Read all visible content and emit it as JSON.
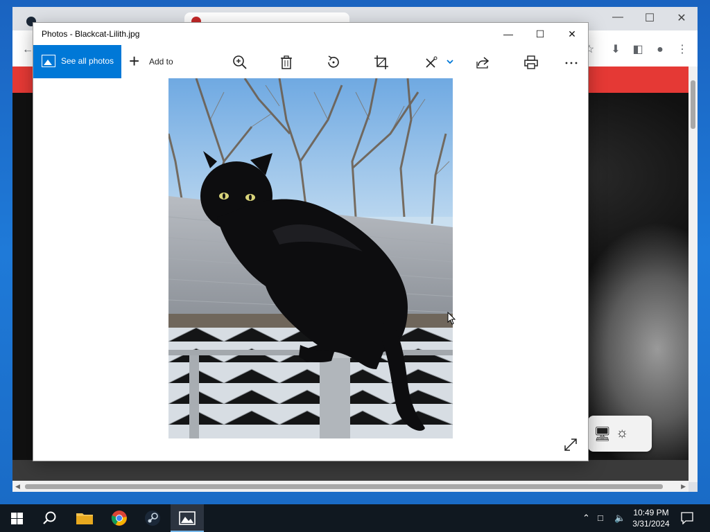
{
  "photos_window": {
    "title": "Photos - Blackcat-Lilith.jpg",
    "see_all_photos_label": "See all photos",
    "add_to_label": "Add to",
    "tools": [
      "zoom-in-icon",
      "delete-icon",
      "rotate-icon",
      "crop-icon",
      "edit-icon",
      "share-icon",
      "print-icon",
      "more-icon"
    ]
  },
  "taskbar": {
    "time": "10:49 PM",
    "date": "3/31/2024",
    "apps": [
      "start",
      "search",
      "file-explorer",
      "chrome",
      "steam",
      "photos"
    ]
  },
  "colors": {
    "accent": "#0078d7",
    "chrome_red_bar": "#e53935",
    "taskbar": "#101820"
  }
}
